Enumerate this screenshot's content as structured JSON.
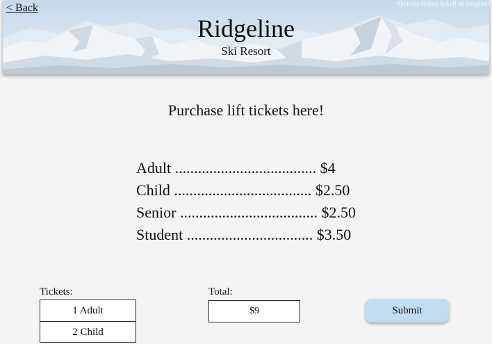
{
  "header": {
    "back_label": "< Back",
    "photo_credit": "Photo by Joshua Sukoff on Unsplash",
    "title": "Ridgeline",
    "subtitle": "Ski Resort"
  },
  "main": {
    "headline": "Purchase lift tickets here!",
    "prices": [
      {
        "label": "Adult ..................................... $4"
      },
      {
        "label": "Child .................................... $2.50"
      },
      {
        "label": "Senior .................................... $2.50"
      },
      {
        "label": "Student ................................. $3.50"
      }
    ]
  },
  "order": {
    "tickets_label": "Tickets:",
    "tickets": [
      "1 Adult",
      "2 Child"
    ],
    "total_label": "Total:",
    "total_value": "$9",
    "submit_label": "Submit"
  },
  "colors": {
    "page_background": "#f4f4f4",
    "submit_button": "#c2ddf1",
    "sky": "#b9d2ea"
  }
}
